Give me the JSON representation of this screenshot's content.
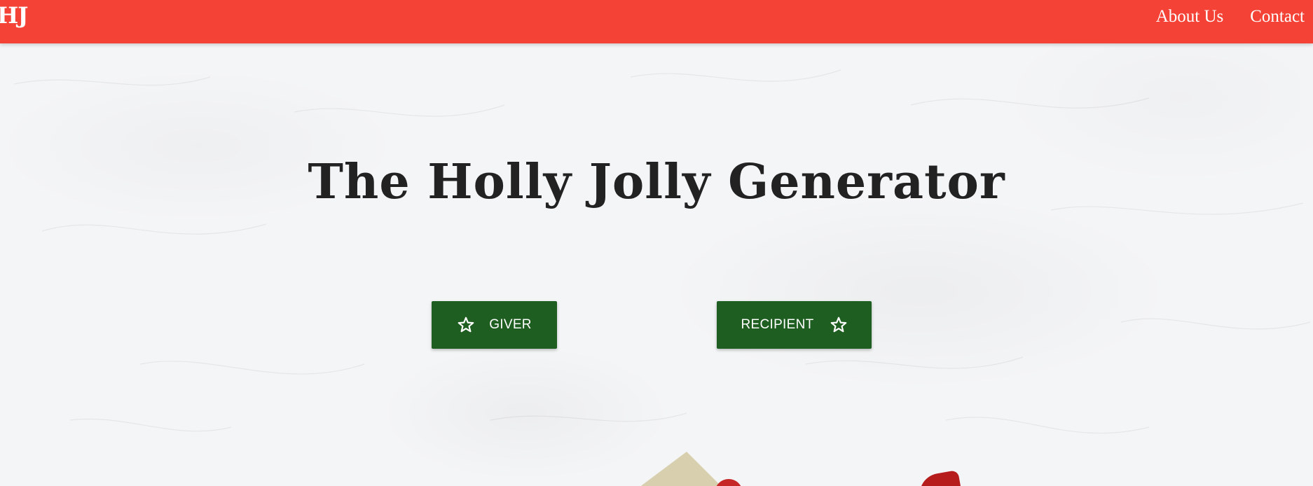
{
  "header": {
    "logo": "HJ",
    "nav": [
      {
        "label": "About Us"
      },
      {
        "label": "Contact"
      }
    ]
  },
  "hero": {
    "title": "The Holly Jolly Generator"
  },
  "buttons": {
    "giver": {
      "label": "GIVER",
      "icon": "star-outline-icon"
    },
    "recipient": {
      "label": "RECIPIENT",
      "icon": "star-outline-icon"
    }
  },
  "colors": {
    "navbar": "#f44336",
    "button": "#1e5e20",
    "title": "#222222",
    "background": "#f4f5f7"
  }
}
